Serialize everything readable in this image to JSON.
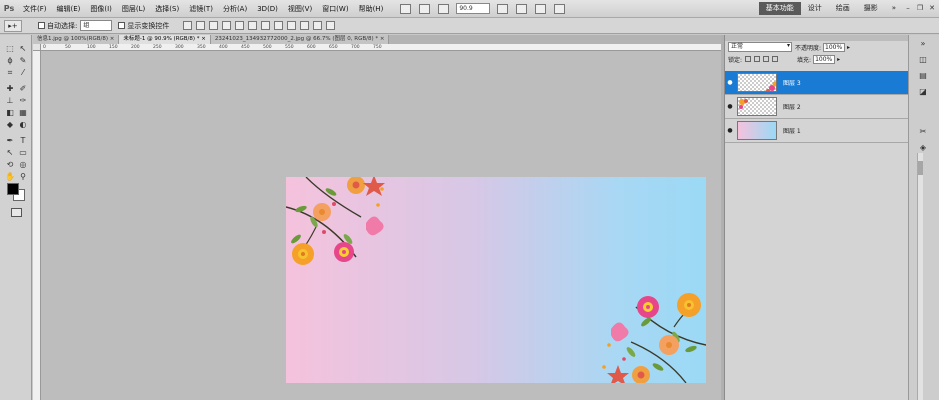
{
  "app": {
    "logo": "Ps",
    "menu": [
      "文件(F)",
      "编辑(E)",
      "图像(I)",
      "图层(L)",
      "选择(S)",
      "滤镜(T)",
      "分析(A)",
      "3D(D)",
      "视图(V)",
      "窗口(W)",
      "帮助(H)"
    ],
    "zoom": "90.9",
    "workspaces": [
      "基本功能",
      "设计",
      "绘画",
      "摄影"
    ],
    "workspace_more": "»"
  },
  "options": {
    "tool_icon": "▸+",
    "auto_select_label": "自动选择:",
    "auto_select_value": "组",
    "show_transform_label": "显示变换控件"
  },
  "tabs": [
    {
      "label": "信息1.jpg @ 100%(RGB/8) ×",
      "active": false
    },
    {
      "label": "未标题-1 @ 90.9% (RGB/8) * ×",
      "active": true
    },
    {
      "label": "23241023_134932772000_2.jpg @ 66.7% (图层 0, RGB/8) * ×",
      "active": false
    }
  ],
  "ruler_ticks": [
    "0",
    "50",
    "100",
    "150",
    "200",
    "250",
    "300",
    "350",
    "400",
    "450",
    "500",
    "550",
    "600",
    "650",
    "700",
    "750"
  ],
  "layers_panel": {
    "blend_mode": "正常",
    "opacity_label": "不透明度:",
    "opacity": "100%",
    "lock_label": "锁定:",
    "fill_label": "填充:",
    "fill": "100%",
    "layers": [
      {
        "name": "图层 3",
        "thumb": "checker",
        "selected": true
      },
      {
        "name": "图层 2",
        "thumb": "checker",
        "selected": false
      },
      {
        "name": "图层 1",
        "thumb": "grad",
        "selected": false
      }
    ]
  },
  "colors": {
    "selected_layer": "#1a7bd5",
    "gradient_left": "#f5c2dc",
    "gradient_right": "#9bd9f5"
  }
}
